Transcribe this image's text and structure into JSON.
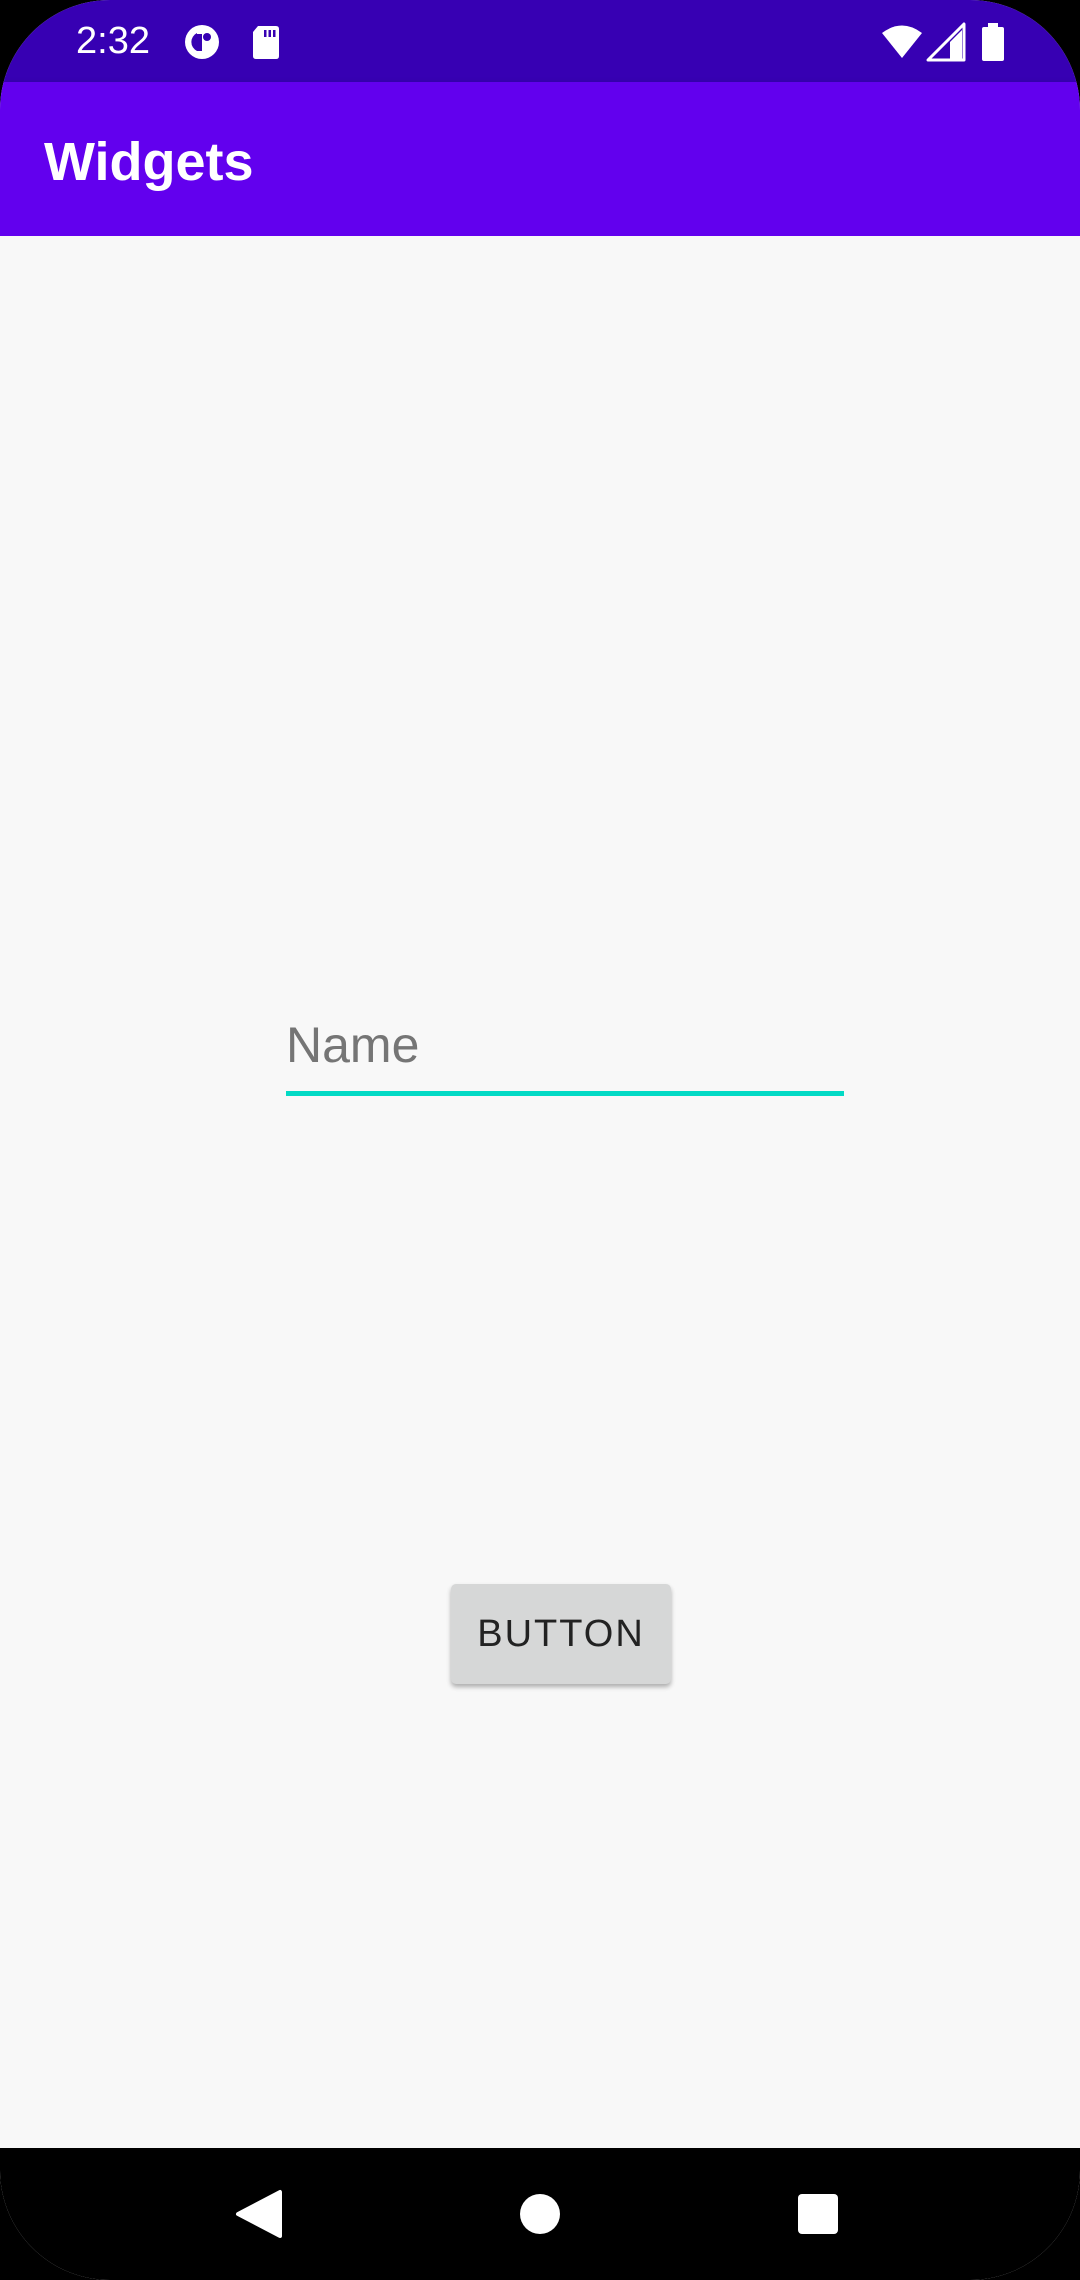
{
  "status_bar": {
    "time": "2:32",
    "left_icons": [
      "data-saver-icon",
      "sd-card-icon"
    ],
    "right_icons": [
      "wifi-icon",
      "cell-signal-icon",
      "battery-icon"
    ]
  },
  "app_bar": {
    "title": "Widgets"
  },
  "form": {
    "name_placeholder": "Name",
    "name_value": ""
  },
  "main": {
    "button_label": "BUTTON"
  },
  "nav_bar": {
    "icons": [
      "back-icon",
      "home-icon",
      "recents-icon"
    ]
  },
  "colors": {
    "status_bar": "#3700b3",
    "app_bar": "#6200ee",
    "accent": "#03dac5",
    "background": "#f8f8f8",
    "button": "#d6d7d7"
  }
}
